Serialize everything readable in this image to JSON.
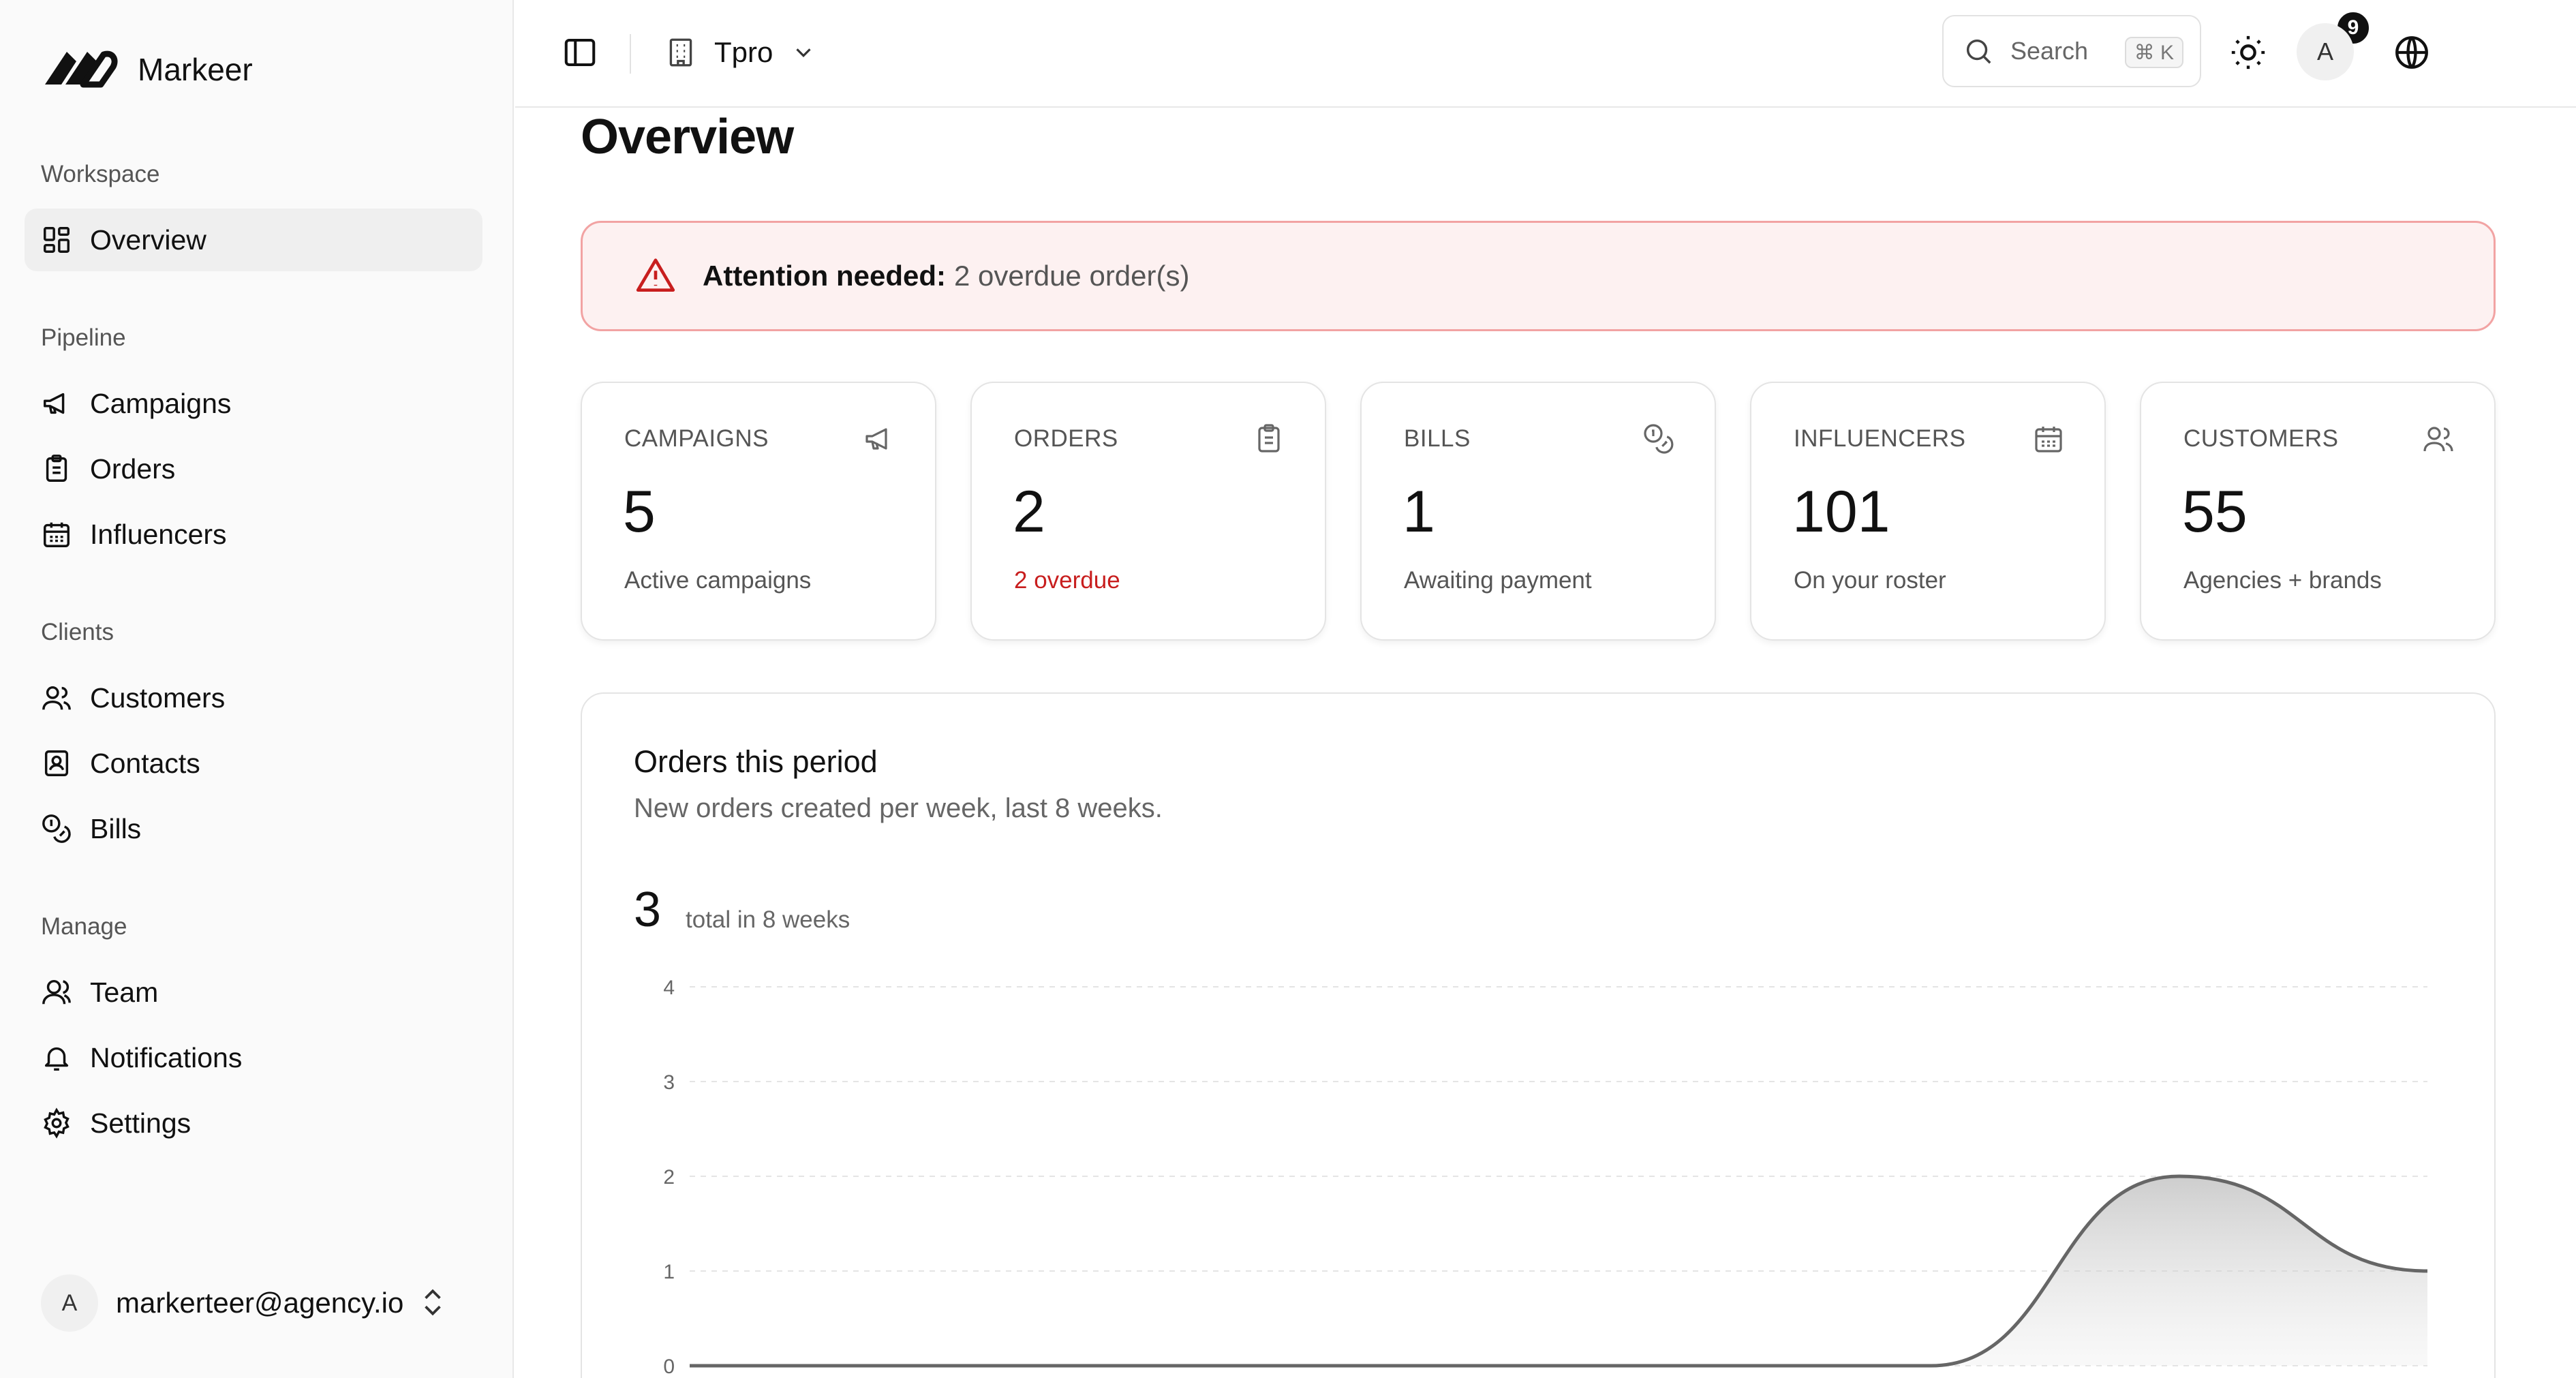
{
  "brand": {
    "name": "Markeer"
  },
  "sidebar": {
    "sections": [
      {
        "label": "Workspace",
        "items": [
          {
            "label": "Overview",
            "icon": "layout-dashboard-icon",
            "active": true
          }
        ]
      },
      {
        "label": "Pipeline",
        "items": [
          {
            "label": "Campaigns",
            "icon": "megaphone-icon"
          },
          {
            "label": "Orders",
            "icon": "clipboard-list-icon"
          },
          {
            "label": "Influencers",
            "icon": "calendar-days-icon"
          }
        ]
      },
      {
        "label": "Clients",
        "items": [
          {
            "label": "Customers",
            "icon": "users-icon"
          },
          {
            "label": "Contacts",
            "icon": "contact-book-icon"
          },
          {
            "label": "Bills",
            "icon": "coins-icon"
          }
        ]
      },
      {
        "label": "Manage",
        "items": [
          {
            "label": "Team",
            "icon": "user-group-icon"
          },
          {
            "label": "Notifications",
            "icon": "bell-icon"
          },
          {
            "label": "Settings",
            "icon": "gear-icon"
          }
        ]
      }
    ],
    "user": {
      "initial": "A",
      "email": "markerteer@agency.io"
    }
  },
  "topbar": {
    "org_name": "Tpro",
    "search_placeholder": "Search",
    "search_shortcut": "⌘ K",
    "notification_count": "9",
    "avatar_initial": "A"
  },
  "page": {
    "title": "Overview"
  },
  "alert": {
    "strong": "Attention needed:",
    "text": "2 overdue order(s)"
  },
  "stats": [
    {
      "label": "CAMPAIGNS",
      "value": "5",
      "sub": "Active campaigns",
      "icon": "megaphone-icon"
    },
    {
      "label": "ORDERS",
      "value": "2",
      "sub": "2 overdue",
      "icon": "clipboard-list-icon",
      "sub_color": "#c81e1e"
    },
    {
      "label": "BILLS",
      "value": "1",
      "sub": "Awaiting payment",
      "icon": "coins-icon"
    },
    {
      "label": "INFLUENCERS",
      "value": "101",
      "sub": "On your roster",
      "icon": "calendar-days-icon"
    },
    {
      "label": "CUSTOMERS",
      "value": "55",
      "sub": "Agencies + brands",
      "icon": "users-icon"
    }
  ],
  "chart": {
    "title": "Orders this period",
    "description": "New orders created per week, last 8 weeks.",
    "total": "3",
    "total_label": "total in 8 weeks"
  },
  "chart_data": {
    "type": "area",
    "x": [
      1,
      2,
      3,
      4,
      5,
      6,
      7,
      8
    ],
    "values": [
      0,
      0,
      0,
      0,
      0,
      0,
      2,
      1
    ],
    "yticks": [
      "0",
      "1",
      "2",
      "3",
      "4"
    ],
    "ylim": [
      0,
      4
    ],
    "grid": true,
    "line_color": "#666666"
  }
}
